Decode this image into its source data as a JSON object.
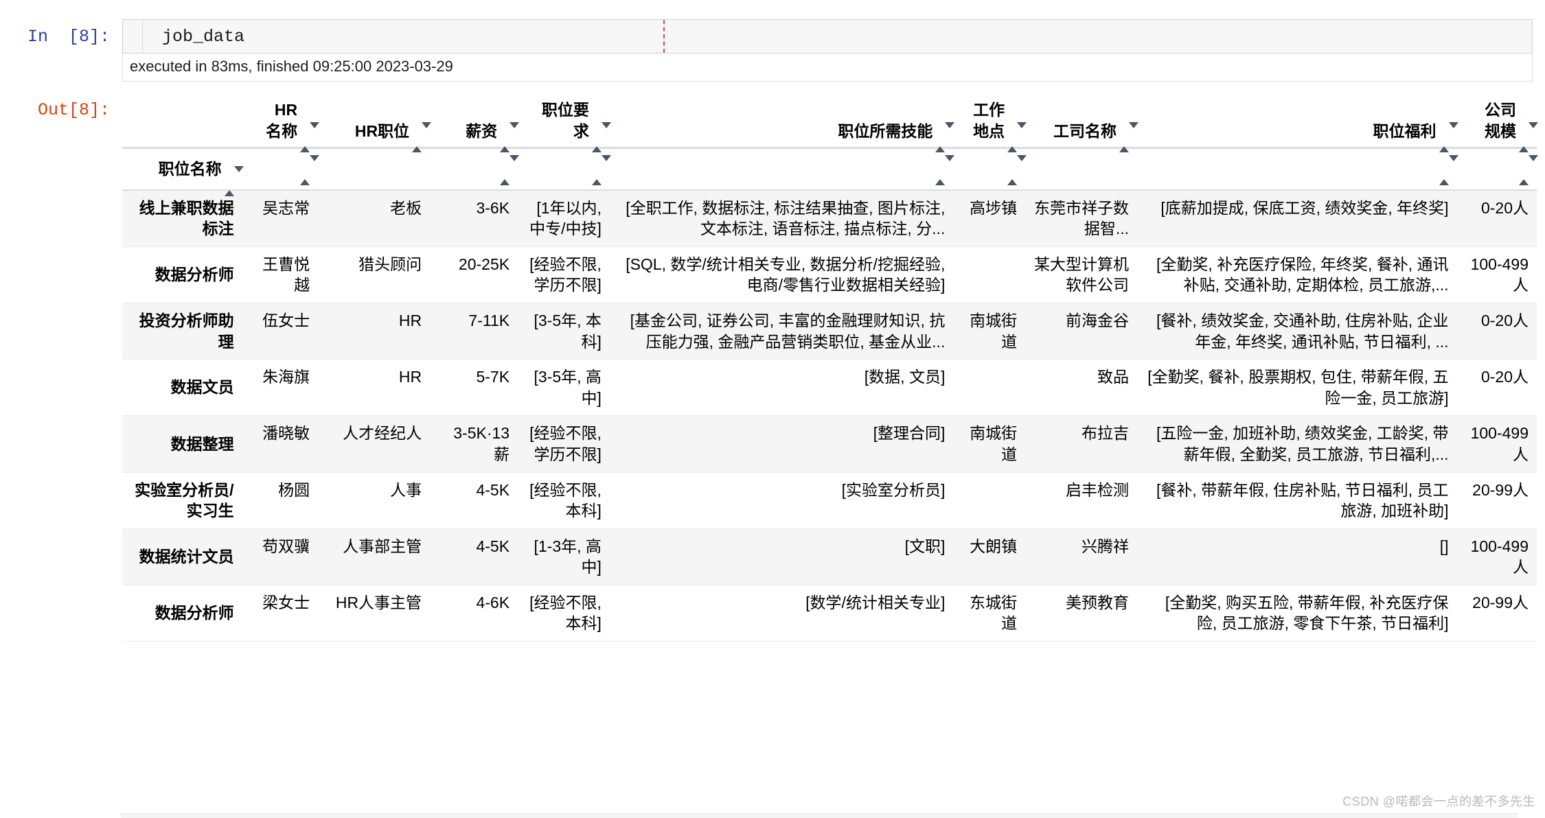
{
  "notebook": {
    "input_prompt": "In  [8]:",
    "output_prompt": "Out[8]:",
    "code": "job_data",
    "exec_status": "executed in 83ms, finished 09:25:00 2023-03-29"
  },
  "watermark": "CSDN @喏都会一点的差不多先生",
  "table": {
    "index_header": "职位名称",
    "columns": [
      "HR\n名称",
      "HR职位",
      "薪资",
      "职位要\n求",
      "职位所需技能",
      "工作\n地点",
      "工司名称",
      "职位福利",
      "公司\n规模"
    ],
    "rows": [
      {
        "index": "线上兼职数据标注",
        "cells": [
          "吴志常",
          "老板",
          "3-6K",
          "[1年以内, 中专/中技]",
          "[全职工作, 数据标注, 标注结果抽查, 图片标注, 文本标注, 语音标注, 描点标注, 分...",
          "高埗镇",
          "东莞市祥子数据智...",
          "[底薪加提成, 保底工资, 绩效奖金, 年终奖]",
          "0-20人"
        ]
      },
      {
        "index": "数据分析师",
        "cells": [
          "王曹悦越",
          "猎头顾问",
          "20-25K",
          "[经验不限, 学历不限]",
          "[SQL, 数学/统计相关专业, 数据分析/挖掘经验, 电商/零售行业数据相关经验]",
          "",
          "某大型计算机软件公司",
          "[全勤奖, 补充医疗保险, 年终奖, 餐补, 通讯补贴, 交通补助, 定期体检, 员工旅游,...",
          "100-499人"
        ]
      },
      {
        "index": "投资分析师助理",
        "cells": [
          "伍女士",
          "HR",
          "7-11K",
          "[3-5年, 本科]",
          "[基金公司, 证券公司, 丰富的金融理财知识, 抗压能力强, 金融产品营销类职位, 基金从业...",
          "南城街道",
          "前海金谷",
          "[餐补, 绩效奖金, 交通补助, 住房补贴, 企业年金, 年终奖, 通讯补贴, 节日福利, ...",
          "0-20人"
        ]
      },
      {
        "index": "数据文员",
        "cells": [
          "朱海旗",
          "HR",
          "5-7K",
          "[3-5年, 高中]",
          "[数据, 文员]",
          "",
          "致品",
          "[全勤奖, 餐补, 股票期权, 包住, 带薪年假, 五险一金, 员工旅游]",
          "0-20人"
        ]
      },
      {
        "index": "数据整理",
        "cells": [
          "潘晓敏",
          "人才经纪人",
          "3-5K·13薪",
          "[经验不限, 学历不限]",
          "[整理合同]",
          "南城街道",
          "布拉吉",
          "[五险一金, 加班补助, 绩效奖金, 工龄奖, 带薪年假, 全勤奖, 员工旅游, 节日福利,...",
          "100-499人"
        ]
      },
      {
        "index": "实验室分析员/实习生",
        "cells": [
          "杨圆",
          "人事",
          "4-5K",
          "[经验不限, 本科]",
          "[实验室分析员]",
          "",
          "启丰检测",
          "[餐补, 带薪年假, 住房补贴, 节日福利, 员工旅游, 加班补助]",
          "20-99人"
        ]
      },
      {
        "index": "数据统计文员",
        "cells": [
          "苟双骥",
          "人事部主管",
          "4-5K",
          "[1-3年, 高中]",
          "[文职]",
          "大朗镇",
          "兴腾祥",
          "[]",
          "100-499人"
        ]
      },
      {
        "index": "数据分析师",
        "cells": [
          "梁女士",
          "HR人事主管",
          "4-6K",
          "[经验不限, 本科]",
          "[数学/统计相关专业]",
          "东城街道",
          "美预教育",
          "[全勤奖, 购买五险, 带薪年假, 补充医疗保险, 员工旅游, 零食下午茶, 节日福利]",
          "20-99人"
        ]
      }
    ]
  }
}
